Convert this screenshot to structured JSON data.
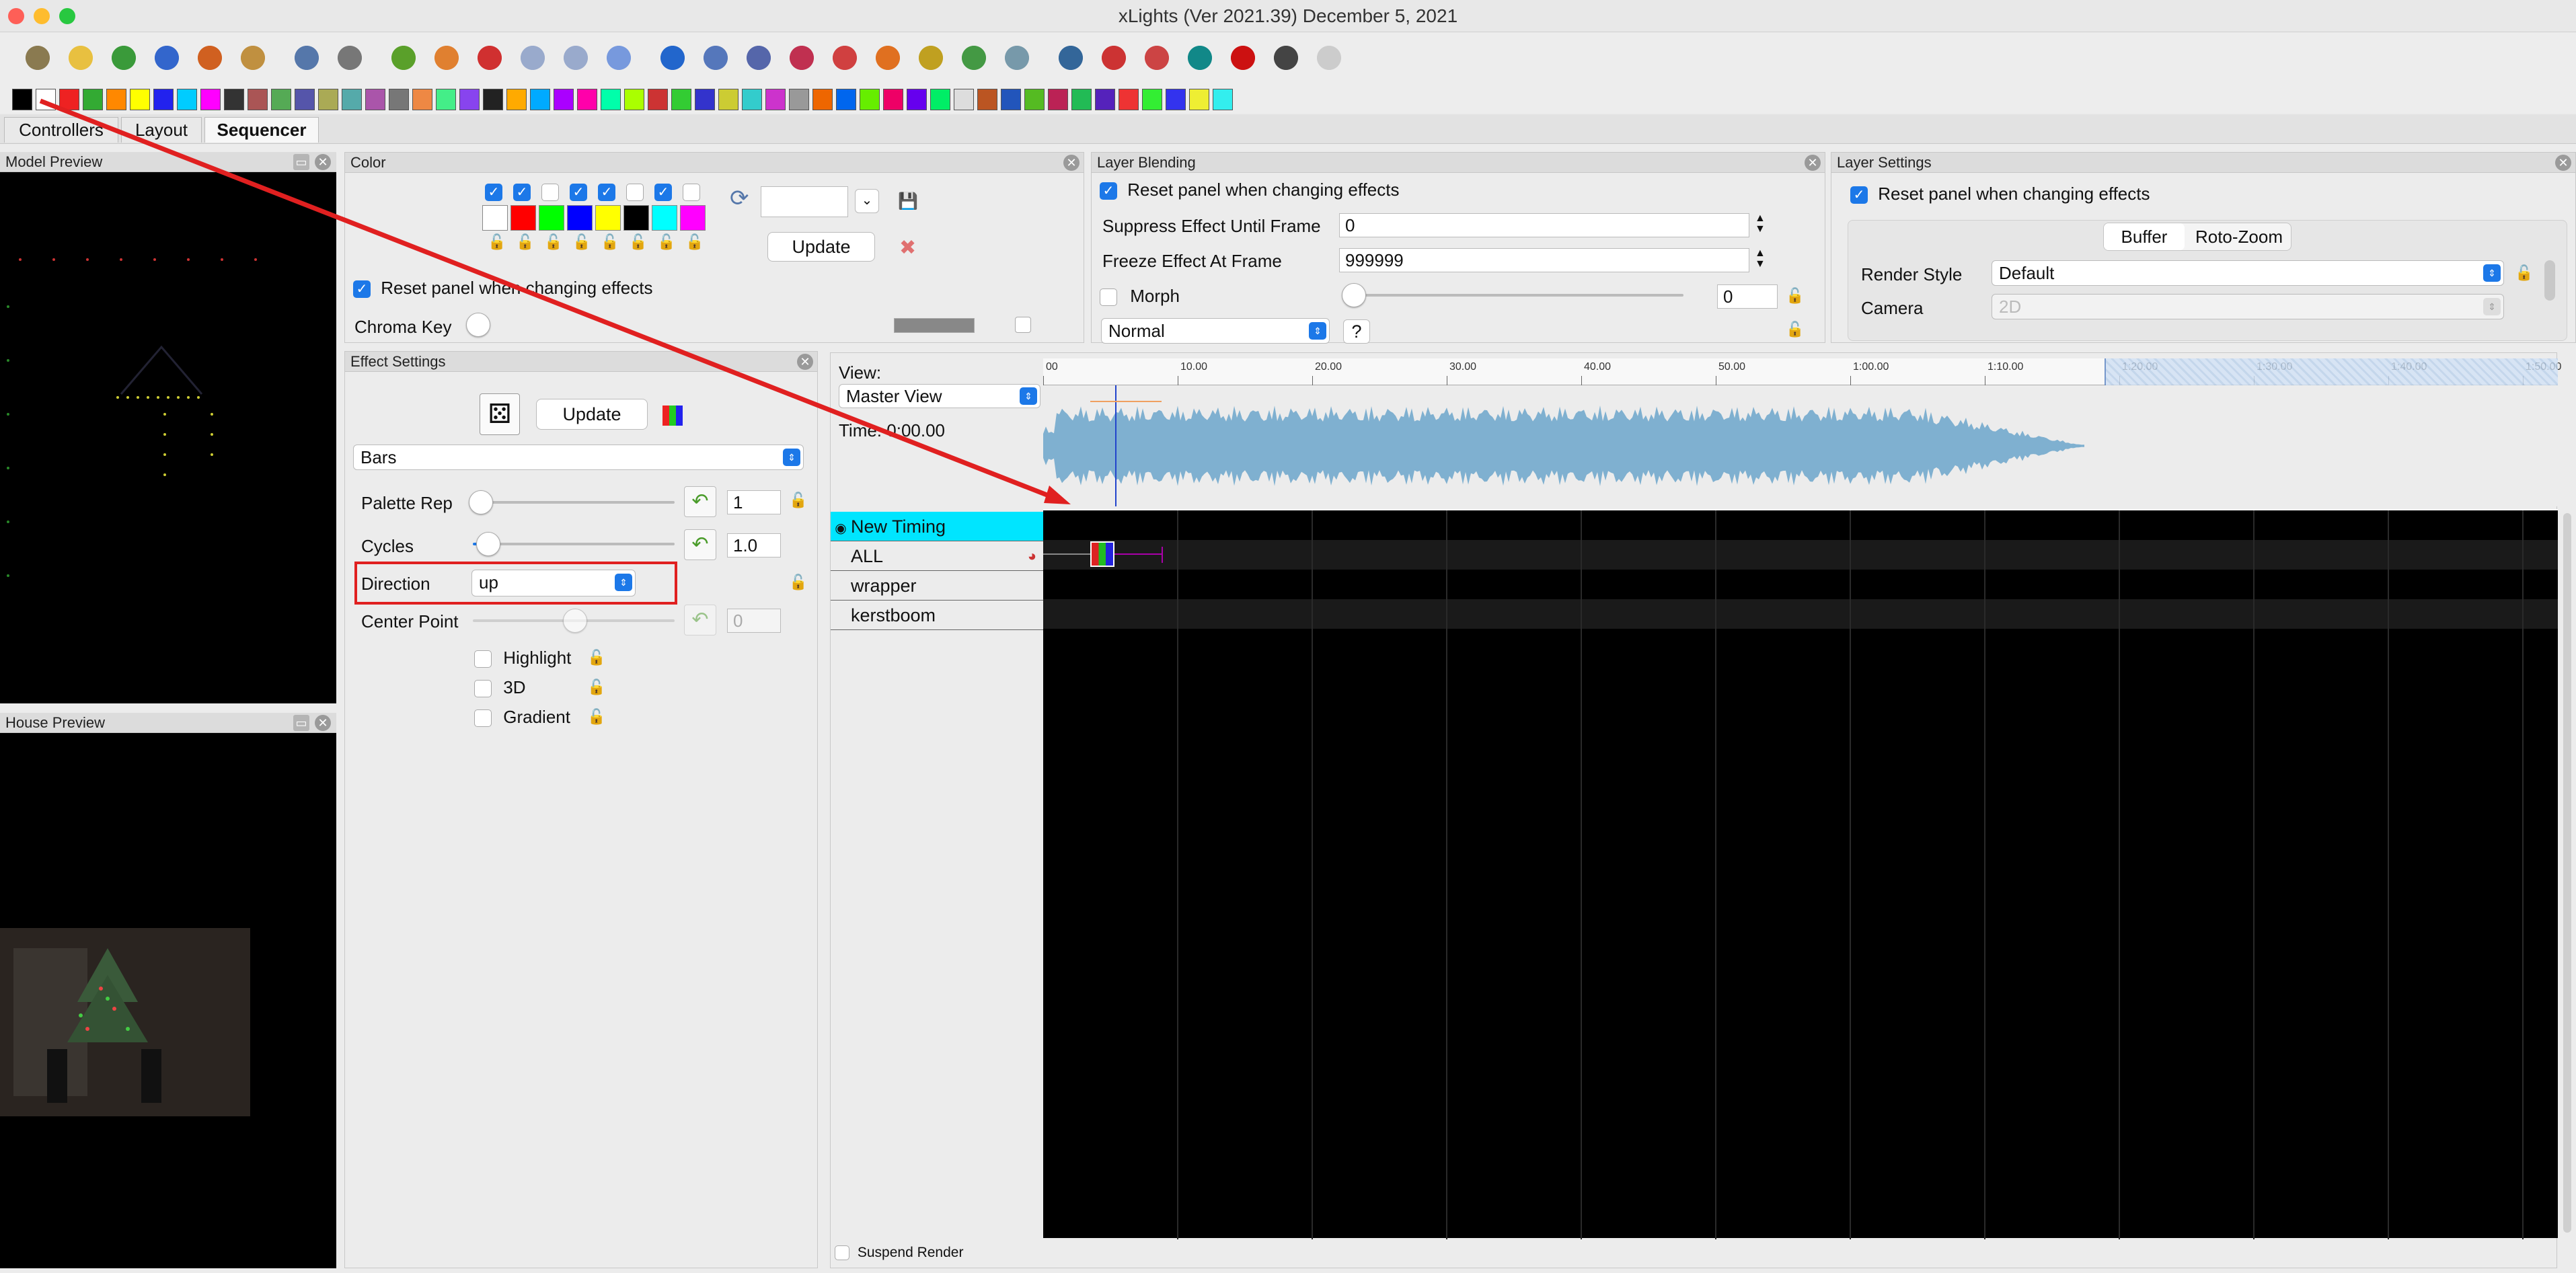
{
  "window": {
    "title": "xLights (Ver 2021.39) December 5, 2021"
  },
  "tabs": [
    {
      "label": "Controllers"
    },
    {
      "label": "Layout"
    },
    {
      "label": "Sequencer"
    }
  ],
  "toolbar": {
    "icons": [
      "new-sequence-icon",
      "open-sequence-icon",
      "open-folder-icon",
      "save-icon",
      "save-as-icon",
      "palette-icon",
      "render-timer-icon",
      "calculator-icon",
      "play-icon",
      "pause-icon",
      "stop-icon",
      "first-frame-icon",
      "last-frame-icon",
      "replay-icon",
      "settings-gear-icon",
      "sliders-icon",
      "effect-assist-icon",
      "layers-icon",
      "color-triangle-icon",
      "house-icon",
      "model-icon",
      "lights-icon",
      "effect-wand-icon",
      "zoom-in-icon",
      "zoom-out-icon",
      "info-icon",
      "help-icon",
      "stop-sign-icon",
      "bulb-off-icon",
      "bulb-on-icon"
    ]
  },
  "model_preview": {
    "title": "Model Preview"
  },
  "house_preview": {
    "title": "House Preview"
  },
  "color_panel": {
    "title": "Color",
    "swatches": [
      "#ffffff",
      "#ff0000",
      "#00ff00",
      "#0000ff",
      "#ffff00",
      "#000000",
      "#00ffff",
      "#ff00ff"
    ],
    "checked": [
      true,
      true,
      false,
      true,
      true,
      false,
      true,
      false
    ],
    "update_label": "Update",
    "reset_label": "Reset panel when changing effects",
    "chroma_key_label": "Chroma Key"
  },
  "layer_blending": {
    "title": "Layer Blending",
    "reset_label": "Reset panel when changing effects",
    "suppress_label": "Suppress Effect Until Frame",
    "suppress_value": "0",
    "freeze_label": "Freeze Effect At Frame",
    "freeze_value": "999999",
    "morph_label": "Morph",
    "morph_value": "0",
    "blend_mode": "Normal",
    "help_label": "?"
  },
  "layer_settings": {
    "title": "Layer Settings",
    "reset_label": "Reset panel when changing effects",
    "tabs": [
      "Buffer",
      "Roto-Zoom"
    ],
    "render_style_label": "Render Style",
    "render_style_value": "Default",
    "camera_label": "Camera",
    "camera_value": "2D"
  },
  "effect_settings": {
    "title": "Effect Settings",
    "update_label": "Update",
    "effect_name": "Bars",
    "palette_rep_label": "Palette Rep",
    "palette_rep_value": "1",
    "palette_rep_level": 0.0,
    "cycles_label": "Cycles",
    "cycles_value": "1.0",
    "cycles_level": 0.04,
    "direction_label": "Direction",
    "direction_value": "up",
    "center_point_label": "Center Point",
    "center_point_value": "0",
    "center_point_level": 0.5,
    "highlight_label": "Highlight",
    "threed_label": "3D",
    "gradient_label": "Gradient"
  },
  "sequencer": {
    "view_label": "View:",
    "view_value": "Master View",
    "time_label": "Time: 0:00.00",
    "ruler": [
      "00",
      "10.00",
      "20.00",
      "30.00",
      "40.00",
      "50.00",
      "1:00.00",
      "1:10.00",
      "1:20.00",
      "1:30.00",
      "1:40.00",
      "1:50.00"
    ],
    "rows": [
      {
        "label": "New Timing"
      },
      {
        "label": "ALL"
      },
      {
        "label": "wrapper"
      },
      {
        "label": "kerstboom"
      }
    ],
    "suspend_render_label": "Suspend Render"
  },
  "colors": {
    "timing_row": "#00e5ff",
    "accent": "#1c78e8",
    "annotation": "#e02020",
    "waveform": "#7fb0d0"
  }
}
